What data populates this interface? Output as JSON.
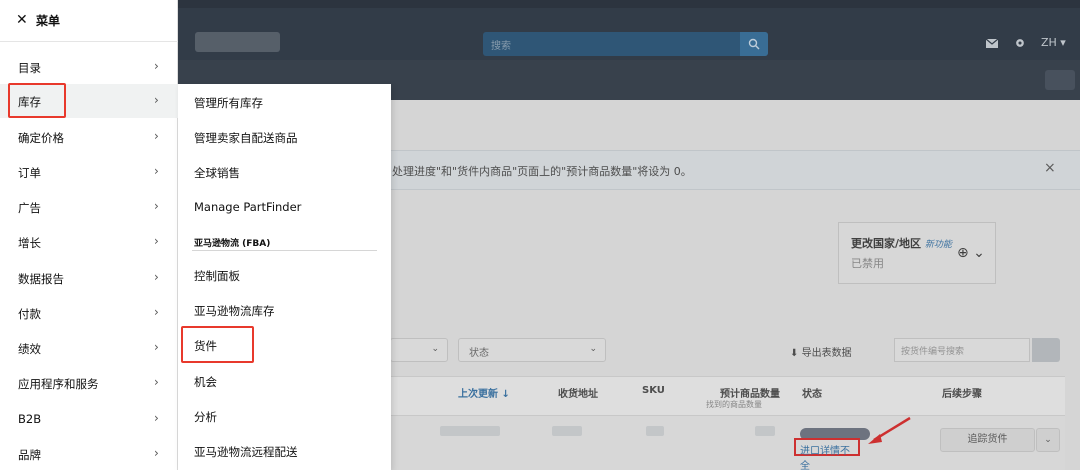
{
  "menu": {
    "title": "菜单",
    "close_icon": "close-icon",
    "items": [
      {
        "label": "目录",
        "chevron": "›"
      },
      {
        "label": "库存",
        "chevron": "›"
      },
      {
        "label": "确定价格",
        "chevron": "›"
      },
      {
        "label": "订单",
        "chevron": "›"
      },
      {
        "label": "广告",
        "chevron": "›"
      },
      {
        "label": "增长",
        "chevron": "›"
      },
      {
        "label": "数据报告",
        "chevron": "›"
      },
      {
        "label": "付款",
        "chevron": "›"
      },
      {
        "label": "绩效",
        "chevron": "›"
      },
      {
        "label": "应用程序和服务",
        "chevron": "›"
      },
      {
        "label": "B2B",
        "chevron": "›"
      },
      {
        "label": "品牌",
        "chevron": "›"
      }
    ],
    "active_item": "库存"
  },
  "submenu": {
    "items": [
      "管理所有库存",
      "管理卖家自配送商品",
      "全球销售",
      "Manage PartFinder"
    ],
    "section_heading": "亚马逊物流 (FBA)",
    "fba_items": [
      "控制面板",
      "亚马逊物流库存",
      "货件",
      "机会",
      "分析",
      "亚马逊物流远程配送"
    ]
  },
  "background": {
    "search_placeholder": "搜索",
    "language": "ZH ▾",
    "banner_text": "处理进度\"和\"货件内商品\"页面上的\"预计商品数量\"将设为 0。",
    "banner_close": "×",
    "country_title": "更改国家/地区",
    "country_edit": "新功能",
    "country_status": "已禁用",
    "status_filter": "状态",
    "export_label": "导出表数据",
    "shipment_search_placeholder": "按货件编号搜索",
    "table_headers": {
      "updated": "上次更新",
      "address": "收货地址",
      "sku": "SKU",
      "expected_qty": "预计商品数量",
      "expected_qty_sub": "找到的商品数量",
      "status": "状态",
      "next_step": "后续步骤"
    },
    "row": {
      "status_link": "进口详情不全",
      "track_button": "追踪货件"
    }
  },
  "colors": {
    "highlight": "#e8392c",
    "topbar": "#232f3e",
    "link": "#2e6fa8"
  }
}
